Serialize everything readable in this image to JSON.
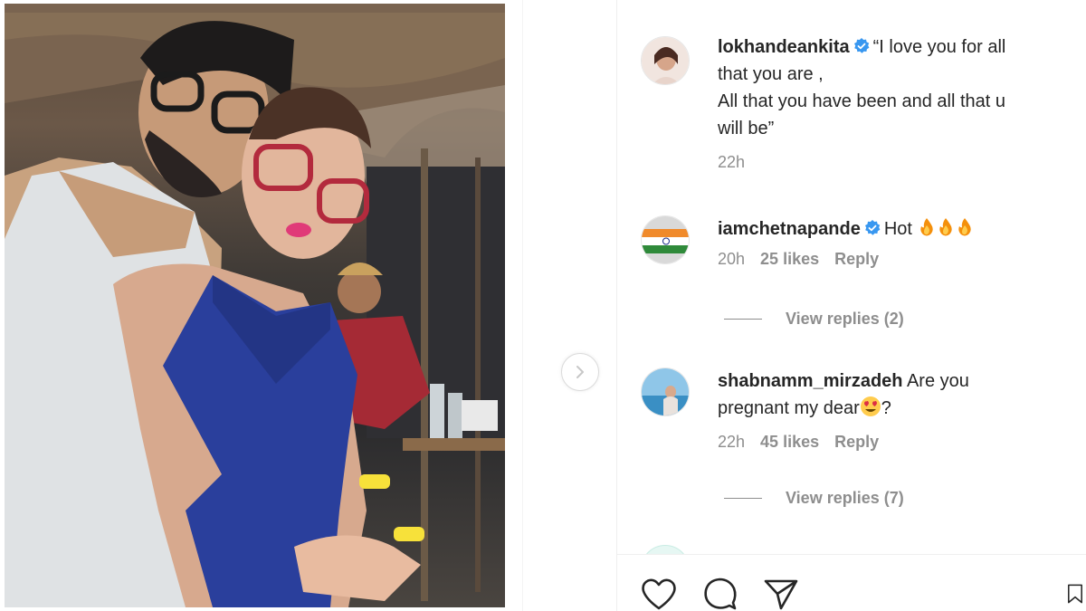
{
  "post": {
    "image_description_icon": "photo",
    "next_icon": "chevron-right-icon"
  },
  "comments": [
    {
      "username": "lokhandeankita",
      "verified": true,
      "text_lines": [
        "“I love you for all",
        "that you are ,",
        "All that you have been and all that u",
        "will be”"
      ],
      "time": "22h"
    },
    {
      "username": "iamchetnapande",
      "verified": true,
      "text": "Hot",
      "emojis": [
        "fire",
        "fire",
        "fire"
      ],
      "time": "20h",
      "likes": "25 likes",
      "reply": "Reply",
      "view_replies": "View replies (2)"
    },
    {
      "username": "shabnamm_mirzadeh",
      "verified": false,
      "text_before": "Are you",
      "text_line2": "pregnant my dear",
      "emoji": "heart-eyes",
      "text_after": "?",
      "time": "22h",
      "likes": "45 likes",
      "reply": "Reply",
      "view_replies": "View replies (7)"
    }
  ],
  "actions": {
    "like_icon": "heart-icon",
    "comment_icon": "comment-icon",
    "share_icon": "share-icon",
    "save_icon": "bookmark-icon"
  },
  "colors": {
    "verified": "#3897f0",
    "muted": "#8e8e8e",
    "text": "#262626"
  }
}
